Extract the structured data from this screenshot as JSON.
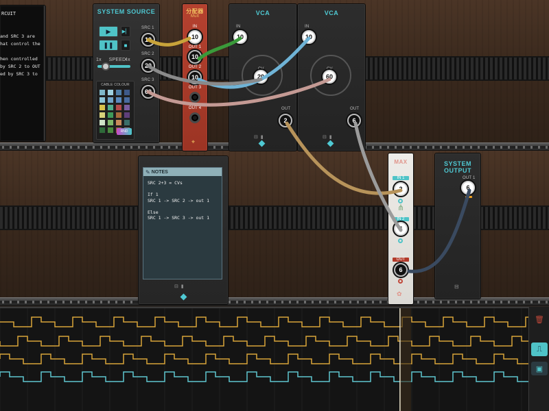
{
  "colors": {
    "accent": "#4fc9d3",
    "cable_yellow": "#c8a33a",
    "cable_green": "#3a9a3a",
    "cable_blue": "#6fb3d6",
    "cable_pink": "#c49a94",
    "cable_tan": "#b7935a",
    "cable_gray": "#9b9b9b",
    "cable_navy": "#3a4a60",
    "mult_red": "#b23a2a",
    "max_panel": "#e8e6e1"
  },
  "circuit_text": {
    "title": "RCUIT",
    "lines": [
      "and SRC 3 are",
      "hat control the",
      "",
      "hen controlled",
      "by SRC 2 to OUT",
      "ed by SRC 3 to"
    ]
  },
  "system_source": {
    "title": "SYSTEM SOURCE",
    "speed_label": "SPEED",
    "speed_min": "1x",
    "speed_max": "4x",
    "speed_value": 0.25,
    "cable_colour_label": "CABLE COLOUR",
    "rnd_label": "RND",
    "sources": [
      {
        "label": "SRC 1",
        "value": "10"
      },
      {
        "label": "SRC 2",
        "value": "20"
      },
      {
        "label": "SRC 3",
        "value": "60"
      }
    ],
    "swatches": [
      "#7fb8c9",
      "#9ed1e0",
      "#4f7fa8",
      "#3e5a8a",
      "#8ec6d8",
      "#6fa4c9",
      "#5b8abf",
      "#496b9f",
      "#d8c24a",
      "#4fae8c",
      "#b34a4a",
      "#7a5c9f",
      "#d8d27a",
      "#3f9a5a",
      "#a56a3a",
      "#5e3f7a",
      "#cfe4c8",
      "#7fb86a",
      "#c78a5a",
      "#3a6e6a",
      "#2e6a3a",
      "#4a8a3f",
      "#9a5a3a",
      "#7a7a7a"
    ]
  },
  "mult": {
    "title": "分配器",
    "subtitle": "Mult",
    "in_label": "IN",
    "in_value": "10",
    "outs": [
      {
        "label": "OUT 1",
        "value": "10"
      },
      {
        "label": "OUT 2",
        "value": "10"
      },
      {
        "label": "OUT 3",
        "value": ""
      },
      {
        "label": "OUT 4",
        "value": ""
      }
    ]
  },
  "vca1": {
    "title": "VCA",
    "in_label": "IN",
    "in_value": "10",
    "cv_label": "CV",
    "cv_value": "20",
    "out_label": "OUT",
    "out_value": "2"
  },
  "vca2": {
    "title": "VCA",
    "in_label": "IN",
    "in_value": "10",
    "cv_label": "CV",
    "cv_value": "60",
    "out_label": "OUT",
    "out_value": "6"
  },
  "notes": {
    "title": "NOTES",
    "lines": [
      "SRC 2+3 = CVs",
      "",
      "If 1",
      "SRC 1 -> SRC 2 -> out 1",
      "",
      "Else",
      "SRC 1 -> SRC 3 -> out 1"
    ]
  },
  "max": {
    "title": "MAX",
    "in1_label": "IN 1",
    "in1_value": "2",
    "in2_label": "IN 2",
    "in2_value": "6",
    "out_label": "OUT",
    "out_value": "6"
  },
  "system_output": {
    "title": "SYSTEM OUTPUT",
    "out_label": "OUT 1",
    "out_value": "6"
  },
  "footer_icons": "⊟ ▮",
  "scope": {
    "trace_colors": [
      "#d9a53a",
      "#d9a53a",
      "#d9a53a",
      "#5fc6d0"
    ],
    "playhead": 0.757
  },
  "scope_side": {
    "delete_icon": "trash-icon",
    "mode_icon": "square-wave-icon",
    "save_icon": "device-icon"
  }
}
